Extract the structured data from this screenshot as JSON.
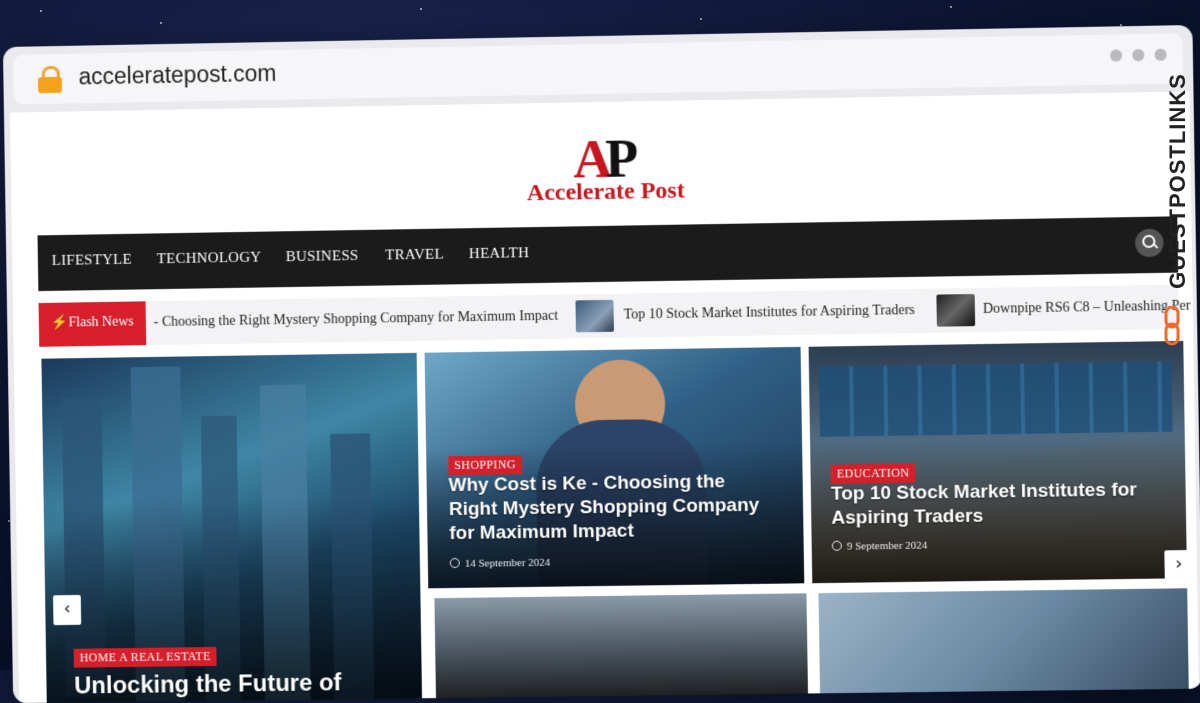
{
  "browser": {
    "url": "acceleratepost.com"
  },
  "logo": {
    "initials_a": "A",
    "initials_p": "P",
    "name": "Accelerate Post"
  },
  "nav": {
    "items": [
      "LIFESTYLE",
      "TECHNOLOGY",
      "BUSINESS",
      "TRAVEL",
      "HEALTH"
    ]
  },
  "ticker": {
    "label": "Flash News",
    "items": [
      "- Choosing the Right Mystery Shopping Company for Maximum Impact",
      "Top 10 Stock Market Institutes for Aspiring Traders",
      "Downpipe RS6 C8 – Unleashing Per"
    ]
  },
  "cards": [
    {
      "category": "HOME A REAL ESTATE",
      "title": "Unlocking the Future of"
    },
    {
      "category": "SHOPPING",
      "title": "Why Cost is Ke - Choosing the Right Mystery Shopping Company for Maximum Impact",
      "date": "14 September 2024"
    },
    {
      "category": "EDUCATION",
      "title": "Top 10 Stock Market Institutes for Aspiring Traders",
      "date": "9 September 2024"
    }
  ],
  "side_banner": {
    "text": "GUESTPOSTLINKS"
  },
  "arrows": {
    "prev": "‹",
    "next": "›"
  },
  "colors": {
    "accent": "#d61f2b",
    "nav_bg": "#1b1b1b"
  }
}
